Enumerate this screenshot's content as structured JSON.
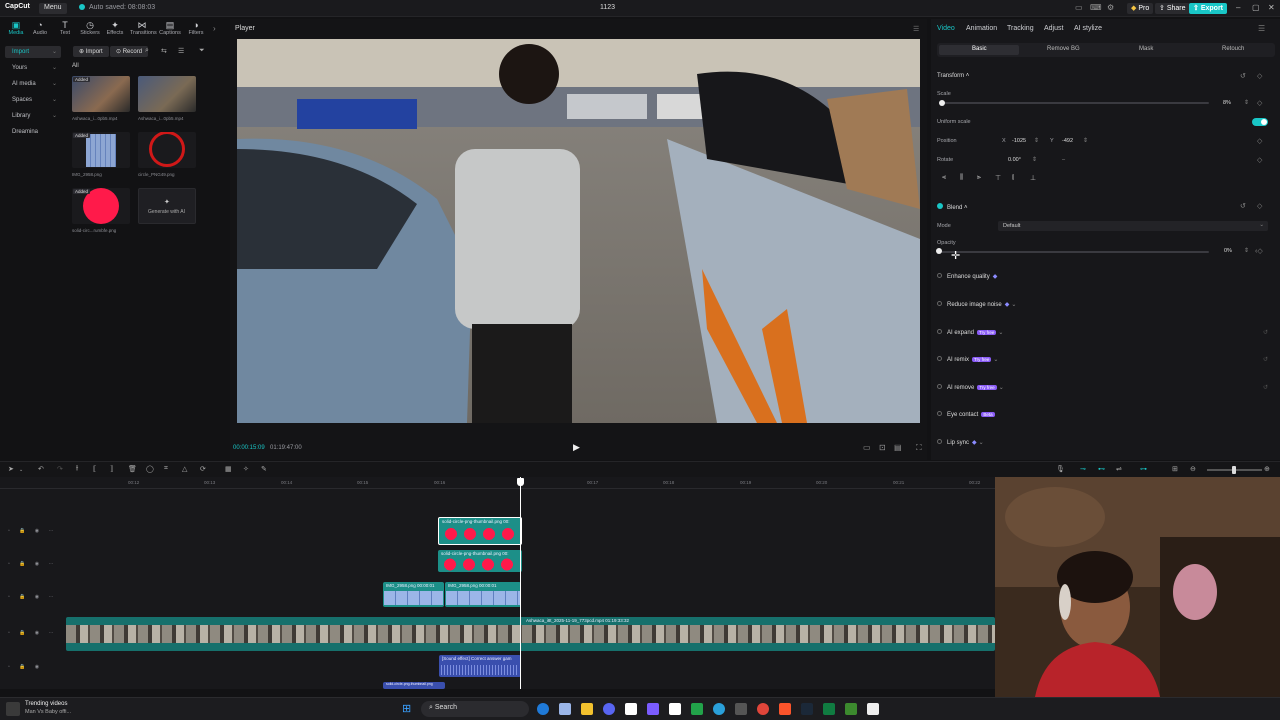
{
  "titlebar": {
    "logo": "CapCut",
    "menu": "Menu",
    "autosave": "Auto saved: 08:08:03",
    "project_title": "1123",
    "pro": "Pro",
    "share": "Share",
    "export": "Export"
  },
  "tools": [
    "Media",
    "Audio",
    "Text",
    "Stickers",
    "Effects",
    "Transitions",
    "Captions",
    "Filters"
  ],
  "sidebar": [
    "Import",
    "Yours",
    "AI media",
    "Spaces",
    "Library",
    "Dreamina"
  ],
  "media": {
    "import": "Import",
    "record": "Record",
    "all": "All",
    "items": [
      {
        "name": "Ashwaca_i...0pb5.mp4",
        "added": "Added"
      },
      {
        "name": "Ashwaca_i...0pb5.mp4",
        "added": ""
      },
      {
        "name": "IMG_2958.png",
        "added": "Added"
      },
      {
        "name": "circle_PNG49.png",
        "added": ""
      },
      {
        "name": "solid-circ...rumbfe.png",
        "added": "Added"
      },
      {
        "name": "Generate with AI",
        "added": ""
      }
    ]
  },
  "player": {
    "title": "Player",
    "timecode": "00:00:15:09",
    "total": "01:19:47:00"
  },
  "props": {
    "tabs": [
      "Video",
      "Animation",
      "Tracking",
      "Adjust",
      "AI stylize"
    ],
    "subtabs": [
      "Basic",
      "Remove BG",
      "Mask",
      "Retouch"
    ],
    "transform": "Transform",
    "scale_label": "Scale",
    "scale_value": "8%",
    "uniform_scale": "Uniform scale",
    "position_label": "Position",
    "pos_x": "-1025",
    "pos_y": "-492",
    "rotate_label": "Rotate",
    "rotate_value": "0.00°",
    "rotate_dash": "–",
    "blend": "Blend",
    "mode_label": "Mode",
    "mode_value": "Default",
    "opacity_label": "Opacity",
    "opacity_value": "0%",
    "features": [
      {
        "label": "Enhance quality",
        "badge": ""
      },
      {
        "label": "Reduce image noise",
        "badge": ""
      },
      {
        "label": "AI expand",
        "badge": "Try free"
      },
      {
        "label": "AI remix",
        "badge": "Try free"
      },
      {
        "label": "AI remove",
        "badge": "Try free"
      },
      {
        "label": "Eye contact",
        "badge": "Beta"
      },
      {
        "label": "Lip sync",
        "badge": ""
      }
    ]
  },
  "timeline": {
    "ruler": [
      "00:12",
      "00:13",
      "00:14",
      "00:15",
      "00:16",
      "00:17",
      "00:18",
      "00:19",
      "00:20",
      "00:21",
      "00:22"
    ],
    "clip1": "solid-circle-png-thumbnail.png 00:",
    "clip2": "solid-circle-png-thumbnail.png 00:",
    "clip3a": "IMG_2958.png 00:00:01",
    "clip3b": "IMG_2958.png 00:00:01",
    "main_clip": "Ashwaca_i8t_2025-11-19_773pcd.mp4  01:19:33:32",
    "audio_clip": "[Sound effect] Correct answer gam",
    "text_clip": "solid-circle-png-thumbnail.png"
  },
  "taskbar": {
    "news_title": "Trending videos",
    "news_sub": "Man Vs Baby offi...",
    "search": "Search"
  },
  "colors": {
    "accent": "#19c6c6",
    "clip_teal": "#1c8f88",
    "circle_red": "#ff1a4a"
  }
}
